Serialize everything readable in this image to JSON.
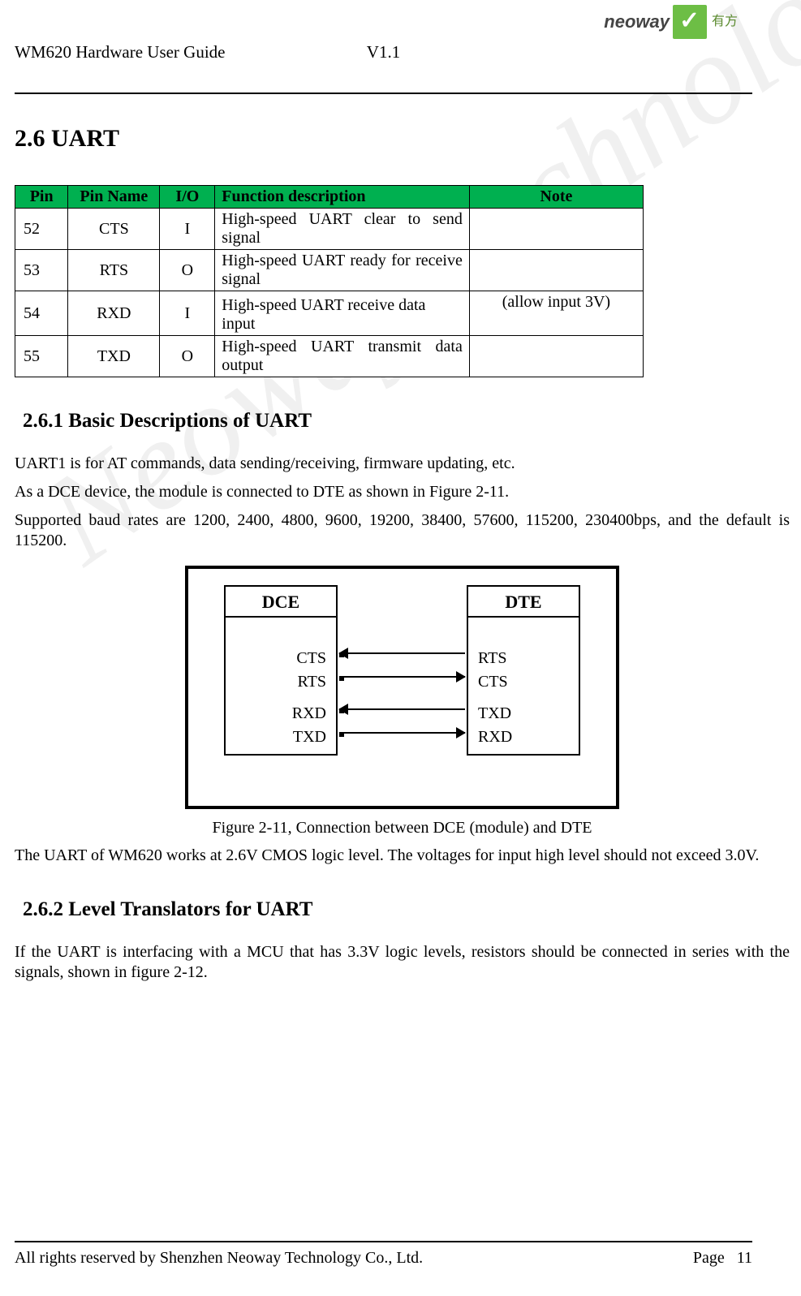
{
  "header": {
    "title": "WM620 Hardware User Guide",
    "version": "V1.1",
    "logo": {
      "name": "neoway",
      "cn": "有方"
    }
  },
  "section": {
    "number_title": "2.6    UART"
  },
  "table": {
    "headers": {
      "pin": "Pin",
      "pin_name": "Pin Name",
      "io": "I/O",
      "func": "Function description",
      "note": "Note"
    },
    "rows": [
      {
        "pin": "52",
        "name": "CTS",
        "io": "I",
        "func_l1": "High-speed   UART   clear   to   send",
        "func_l2": "signal",
        "note": ""
      },
      {
        "pin": "53",
        "name": "RTS",
        "io": "O",
        "func_l1": "High-speed UART ready for receive",
        "func_l2": "signal",
        "note": ""
      },
      {
        "pin": "54",
        "name": "RXD",
        "io": "I",
        "func_single": "High-speed UART receive data input",
        "note": "(allow input 3V)"
      },
      {
        "pin": "55",
        "name": "TXD",
        "io": "O",
        "func_l1": "High-speed   UART   transmit   data",
        "func_l2": "output",
        "note": ""
      }
    ]
  },
  "sub1": {
    "title": "2.6.1 Basic Descriptions of UART",
    "p1": "UART1 is for AT commands, data sending/receiving, firmware updating, etc.",
    "p2": "As a DCE device, the module is connected to DTE as shown in Figure 2-11.",
    "p3": "Supported baud rates are 1200, 2400, 4800, 9600, 19200, 38400, 57600, 115200, 230400bps, and the default is 115200.",
    "figure_caption": "Figure 2-11, Connection between DCE (module) and DTE",
    "p_after": "The UART of WM620 works at 2.6V CMOS logic level. The voltages for input high level should not exceed 3.0V."
  },
  "diagram": {
    "dce": {
      "title": "DCE",
      "s1": "CTS",
      "s2": "RTS",
      "s3": "RXD",
      "s4": "TXD"
    },
    "dte": {
      "title": "DTE",
      "s1": "RTS",
      "s2": "CTS",
      "s3": "TXD",
      "s4": "RXD"
    }
  },
  "sub2": {
    "title": "2.6.2 Level Translators for UART",
    "p1": "If the UART is interfacing with a MCU that has 3.3V logic levels, resistors should be connected in series with the signals, shown in figure 2-12."
  },
  "footer": {
    "left": "All rights reserved by Shenzhen Neoway Technology Co., Ltd.",
    "right_label": "Page",
    "right_num": "11"
  },
  "watermark": "Neoway Technology Co., Ltd"
}
